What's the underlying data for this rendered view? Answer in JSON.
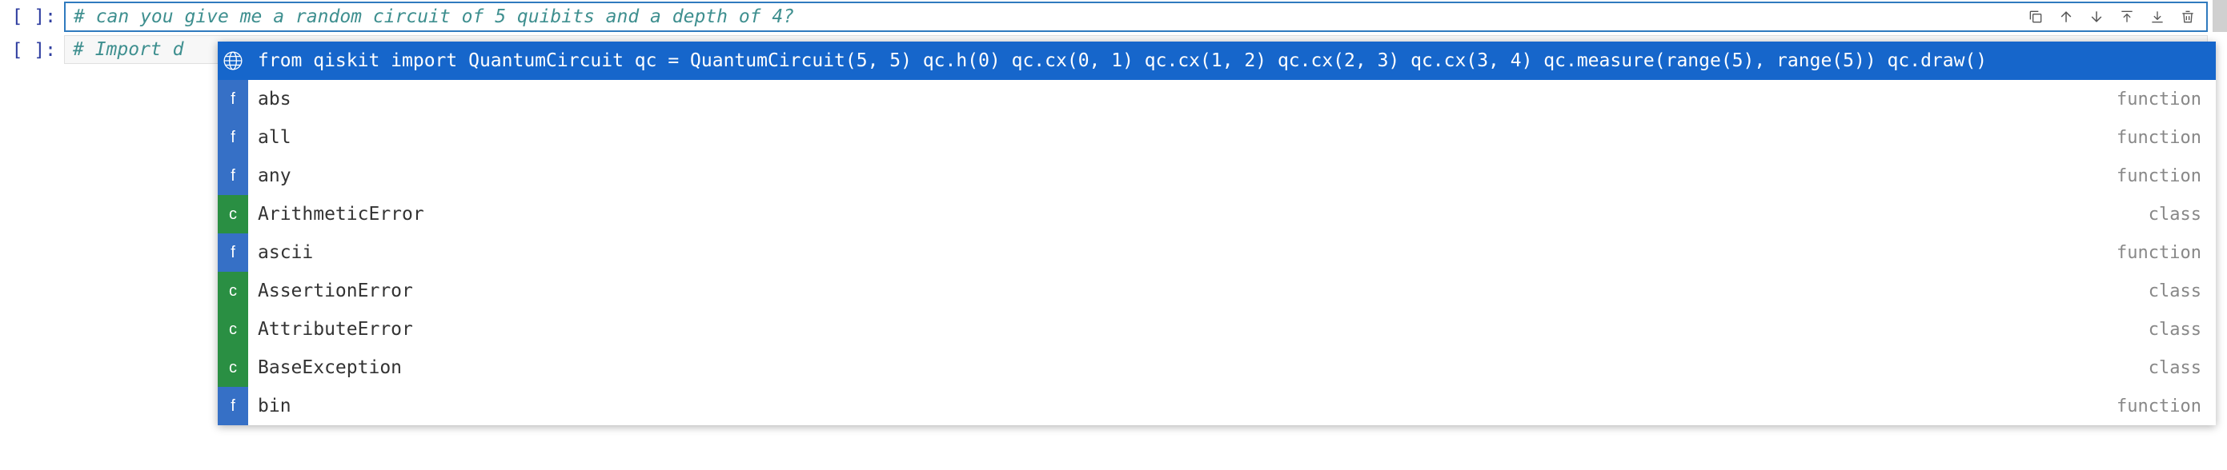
{
  "cells": [
    {
      "prompt": "[ ]:",
      "active": true,
      "code": "# can you give me a random circuit of 5 quibits and a depth of 4?"
    },
    {
      "prompt": "[ ]:",
      "active": false,
      "code": "# Import d"
    }
  ],
  "toolbar_icons": [
    "copy-icon",
    "arrow-up-icon",
    "arrow-down-icon",
    "insert-above-icon",
    "insert-below-icon",
    "trash-icon"
  ],
  "autocomplete": {
    "items": [
      {
        "kind": "ai",
        "label": "from qiskit import QuantumCircuit qc = QuantumCircuit(5, 5) qc.h(0) qc.cx(0, 1) qc.cx(1, 2) qc.cx(2, 3) qc.cx(3, 4) qc.measure(range(5), range(5)) qc.draw()",
        "type": "",
        "selected": true
      },
      {
        "kind": "f",
        "label": "abs",
        "type": "function",
        "selected": false
      },
      {
        "kind": "f",
        "label": "all",
        "type": "function",
        "selected": false
      },
      {
        "kind": "f",
        "label": "any",
        "type": "function",
        "selected": false
      },
      {
        "kind": "c",
        "label": "ArithmeticError",
        "type": "class",
        "selected": false
      },
      {
        "kind": "f",
        "label": "ascii",
        "type": "function",
        "selected": false
      },
      {
        "kind": "c",
        "label": "AssertionError",
        "type": "class",
        "selected": false
      },
      {
        "kind": "c",
        "label": "AttributeError",
        "type": "class",
        "selected": false
      },
      {
        "kind": "c",
        "label": "BaseException",
        "type": "class",
        "selected": false
      },
      {
        "kind": "f",
        "label": "bin",
        "type": "function",
        "selected": false
      }
    ]
  }
}
